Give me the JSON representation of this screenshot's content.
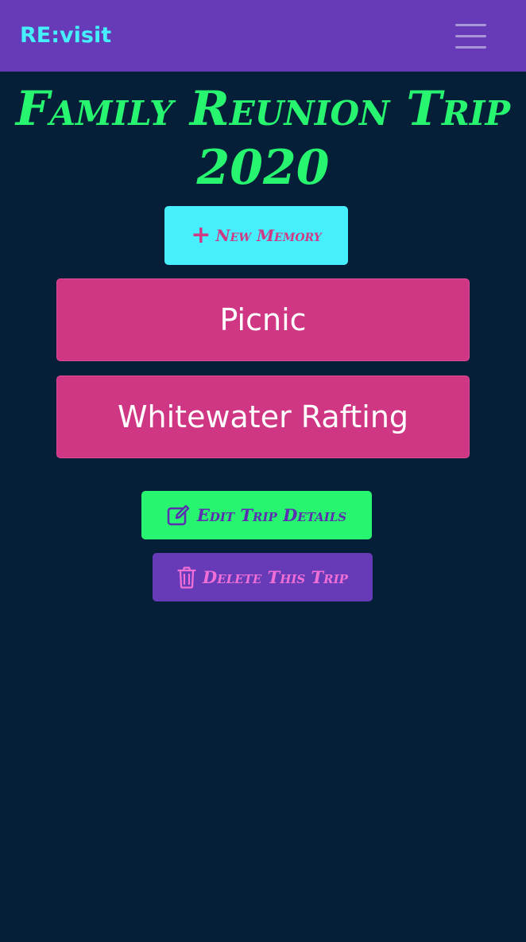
{
  "navbar": {
    "brand": "RE:visit",
    "menu_icon": "hamburger-menu-icon"
  },
  "trip": {
    "title": "Family Reunion Trip 2020"
  },
  "actions": {
    "new_memory_icon": "plus-icon",
    "new_memory_label": "New Memory",
    "edit_icon": "edit-icon",
    "edit_label": "Edit Trip Details",
    "delete_icon": "trash-icon",
    "delete_label": "Delete This Trip"
  },
  "memories": [
    {
      "title": "Picnic"
    },
    {
      "title": "Whitewater Rafting"
    }
  ],
  "colors": {
    "background": "#051f38",
    "navbar": "#673ab7",
    "brand": "#45f0fc",
    "title": "#27f56f",
    "new_memory_bg": "#45f0fc",
    "memory_card_bg": "#cf3683",
    "edit_bg": "#27f56f",
    "delete_bg": "#673ab7"
  }
}
